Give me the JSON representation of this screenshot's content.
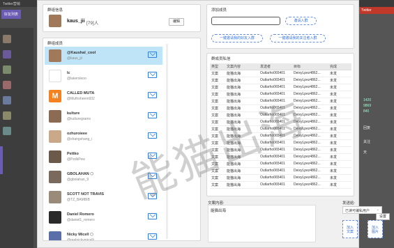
{
  "background": {
    "window_title": "Twitter营销",
    "tab_label": "好友列表",
    "right_tab_label": "Twitter",
    "numbers": [
      "1420",
      "9869",
      "840"
    ],
    "side_labels": [
      "回复",
      "关注",
      "天"
    ],
    "right_button": "设置"
  },
  "group_info": {
    "title": "群组信息",
    "name": "kaus_jii",
    "count": "[79]人",
    "edit_label": "编辑"
  },
  "members": {
    "title": "群组成员",
    "items": [
      {
        "name": "@Kaushal_cool",
        "handle": "@kaus_jii",
        "avatar_color": "#a0785a"
      },
      {
        "name": "Ic",
        "handle": "@lakersleoo",
        "avatar_color": "#ffffff"
      },
      {
        "name": "CALLED MUTA",
        "handle": "@Muthoheem932",
        "avatar_color": "#f58220",
        "letter": "M"
      },
      {
        "name": "kulture",
        "handle": "@kulturegrams",
        "avatar_color": "#8c6b55"
      },
      {
        "name": "ozhuroieee",
        "handle": "@shangshang_i",
        "avatar_color": "#c9a98a"
      },
      {
        "name": "Pettko",
        "handle": "@PzdkPew",
        "avatar_color": "#6b5a4a"
      },
      {
        "name": "GBOLAHAN ⬡",
        "handle": "@gbolahan_9",
        "avatar_color": "#7a6a5e"
      },
      {
        "name": "SCOTT NOT TRAVIS",
        "handle": "@TZ_BAMBIB",
        "avatar_color": "#9a8a7a"
      },
      {
        "name": "Daniel Romero",
        "handle": "@daniel1_romero",
        "avatar_color": "#2a2a2a"
      },
      {
        "name": "Nicky Micell ⬡",
        "handle": "@realnickymicelli",
        "avatar_color": "#5a6fa8"
      }
    ]
  },
  "add_member": {
    "title": "添加成员",
    "input_value": "",
    "add_button": "邀请入群",
    "invite_friends": "一键邀请我的好友入群",
    "invite_followers": "一键邀请我的关注者入群"
  },
  "private_messages": {
    "title": "群成员私信",
    "columns": [
      "类型",
      "文案内容",
      "发送者",
      "目标",
      "完成"
    ],
    "rows": [
      [
        "文案",
        "能猫出海",
        "Outlarho065401",
        "DeixyLpez4862...",
        "未发"
      ],
      [
        "文案",
        "能猫出海",
        "Outlarho065401",
        "DeixyLpez4862...",
        "未发"
      ],
      [
        "文案",
        "能猫出海",
        "Outlarho065401",
        "DeixyLpez4862...",
        "未发"
      ],
      [
        "文案",
        "能猫出海",
        "Outlarho065401",
        "DeixyLpez4862...",
        "未发"
      ],
      [
        "文案",
        "能猫出海",
        "Outlarho065401",
        "DeixyLpez4862...",
        "未发"
      ],
      [
        "文案",
        "能猫出海",
        "Outlarho065401",
        "DeixyLpez4862...",
        "未发"
      ],
      [
        "文案",
        "能猫出海",
        "Outlarho065401",
        "DeixyLpez4862...",
        "未发"
      ],
      [
        "文案",
        "能猫出海",
        "Outlarho065401",
        "DeixyLpez4862...",
        "未发"
      ],
      [
        "文案",
        "能猫出海",
        "Outlarho065401",
        "DeixyLpez4862...",
        "未发"
      ],
      [
        "文案",
        "能猫出海",
        "Outlarho065401",
        "DeixyLpez4862...",
        "未发"
      ],
      [
        "文案",
        "能猫出海",
        "Outlarho065401",
        "DeixyLpez4862...",
        "未发"
      ],
      [
        "文案",
        "能猫出海",
        "Outlarho065401",
        "DeixyLpez4862...",
        "未发"
      ],
      [
        "文案",
        "能猫出海",
        "Outlarho065401",
        "DeixyLpez4862...",
        "未发"
      ],
      [
        "文案",
        "能猫出海",
        "Outlarho065401",
        "DeixyLpez4862...",
        "未发"
      ],
      [
        "文案",
        "能猫出海",
        "Outlarho065401",
        "DeixyLpez4862...",
        "未发"
      ],
      [
        "文案",
        "能猫出海",
        "Outlarho065401",
        "DeixyLpez4862...",
        "未发"
      ],
      [
        "文案",
        "能猫出海",
        "Outlarho065401",
        "DeixyLpez4862...",
        "未发"
      ]
    ]
  },
  "compose": {
    "content_label": "文案内容:",
    "content_value": "能猫出海",
    "method_label": "发送给:",
    "method_value": "已读可编私用户",
    "add_text_button": "加入\n文案",
    "add_image_button": "加入\n图片"
  },
  "watermark": "能猫出海",
  "colors": {
    "accent": "#2f6fd8",
    "selected_row": "#bfe4f7",
    "purple": "#6b5bb3",
    "danger": "#c0392b"
  }
}
